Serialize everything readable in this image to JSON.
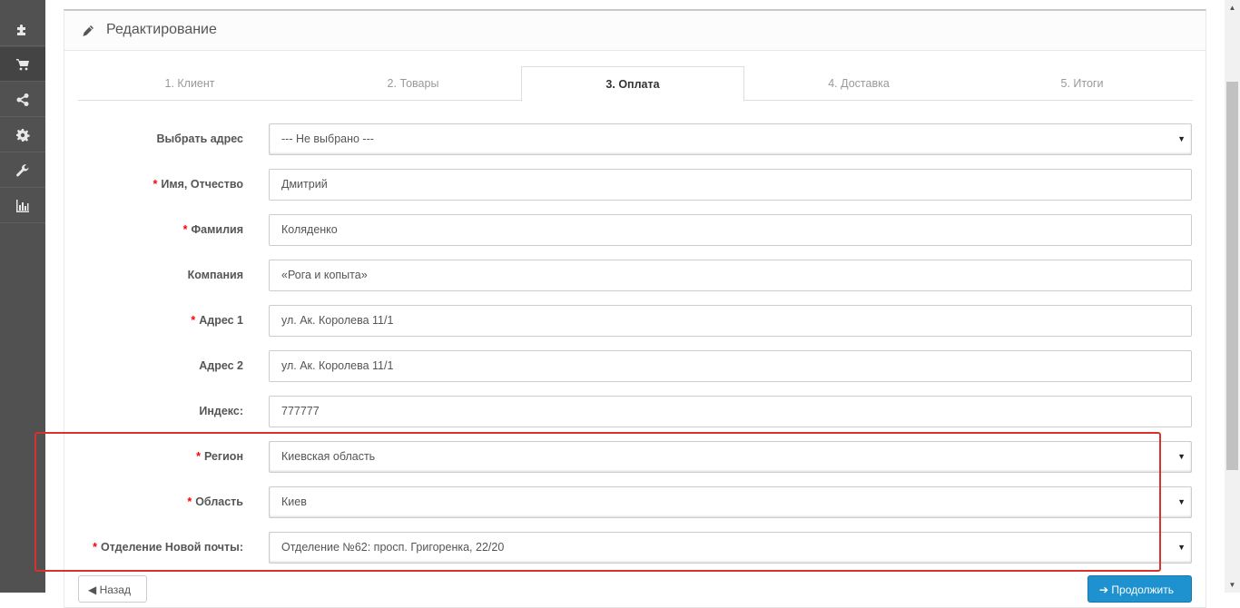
{
  "sidebar": {
    "items": [
      {
        "icon": "puzzle-icon"
      },
      {
        "icon": "cart-icon"
      },
      {
        "icon": "share-icon"
      },
      {
        "icon": "gear-icon"
      },
      {
        "icon": "wrench-icon"
      },
      {
        "icon": "bar-chart-icon"
      }
    ]
  },
  "panel": {
    "title": "Редактирование"
  },
  "tabs": [
    {
      "label": "1. Клиент"
    },
    {
      "label": "2. Товары"
    },
    {
      "label": "3. Оплата"
    },
    {
      "label": "4. Доставка"
    },
    {
      "label": "5. Итоги"
    }
  ],
  "form": {
    "address_select": {
      "label": "Выбрать адрес",
      "value": "--- Не выбрано ---"
    },
    "firstname": {
      "label": "Имя, Отчество",
      "value": "Дмитрий"
    },
    "lastname": {
      "label": "Фамилия",
      "value": "Коляденко"
    },
    "company": {
      "label": "Компания",
      "value": "«Рога и копыта»"
    },
    "address1": {
      "label": "Адрес 1",
      "value": "ул. Ак. Королева 11/1"
    },
    "address2": {
      "label": "Адрес 2",
      "value": "ул. Ак. Королева 11/1"
    },
    "postcode": {
      "label": "Индекс:",
      "value": "777777"
    },
    "region": {
      "label": "Регион",
      "value": "Киевская область"
    },
    "city": {
      "label": "Область",
      "value": "Киев"
    },
    "branch": {
      "label": "Отделение Новой почты:",
      "value": "Отделение №62: просп. Григоренка, 22/20"
    },
    "required_mark": "*"
  },
  "buttons": {
    "back": "Назад",
    "next": "Продолжить"
  },
  "colors": {
    "sidebar_bg": "#515151",
    "highlight_border": "#d9312b",
    "primary_button": "#1e91cf",
    "required": "#ff0000"
  }
}
